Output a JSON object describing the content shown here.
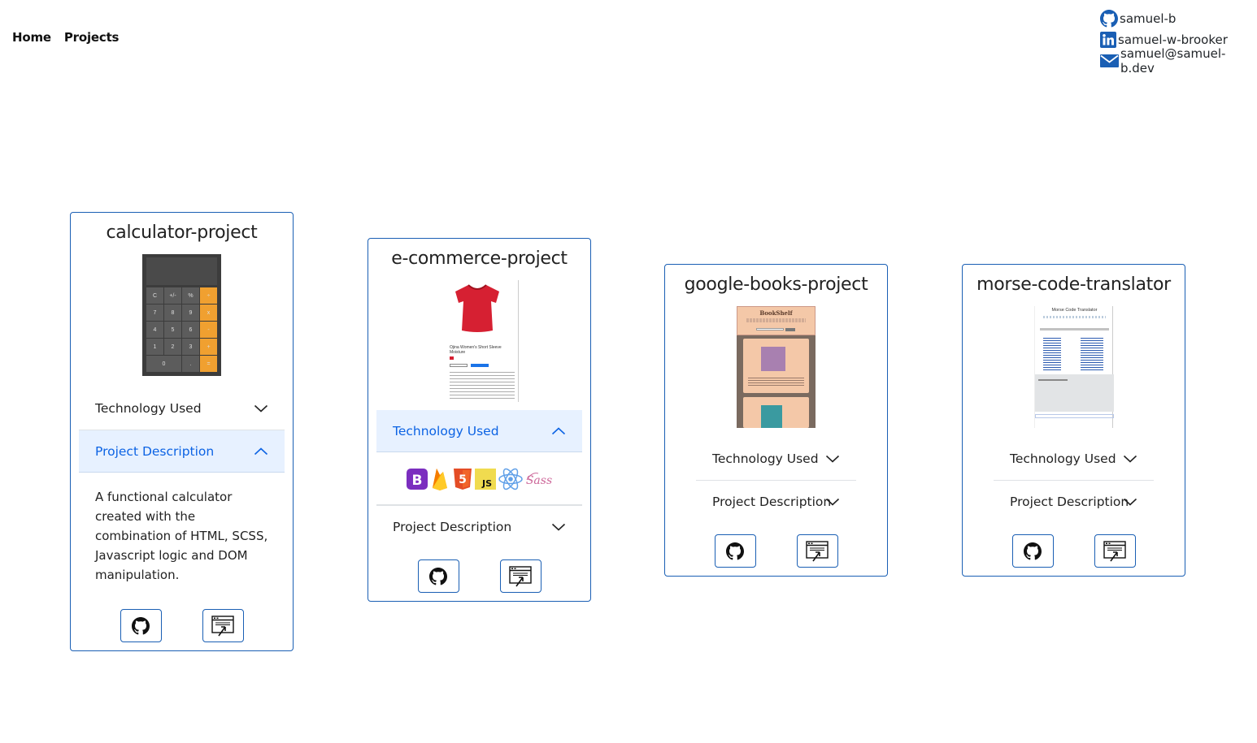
{
  "nav": {
    "home": "Home",
    "projects": "Projects"
  },
  "contacts": {
    "github": "samuel-b",
    "linkedin": "samuel-w-brooker",
    "email": "samuel@samuel-b.dev"
  },
  "accordion": {
    "tech_label": "Technology Used",
    "desc_label": "Project Description"
  },
  "projects": [
    {
      "title": "calculator-project",
      "description": "A functional calculator created with the combination of HTML, SCSS, Javascript logic and DOM manipulation.",
      "calc_keys": [
        "C",
        "+/-",
        "%",
        "÷",
        "7",
        "8",
        "9",
        "x",
        "4",
        "5",
        "6",
        "-",
        "1",
        "2",
        "3",
        "+",
        "0",
        ".",
        "="
      ]
    },
    {
      "title": "e-commerce-project",
      "product_name": "Ojina Women's Short Sleeve Moisture",
      "tech_icons": [
        "bootstrap-icon",
        "firebase-icon",
        "html5-icon",
        "javascript-icon",
        "react-icon",
        "sass-icon"
      ]
    },
    {
      "title": "google-books-project",
      "screenshot_heading": "BookShelf"
    },
    {
      "title": "morse-code-translator",
      "screenshot_heading": "Morse Code Translator"
    }
  ],
  "colors": {
    "accent": "#1a5fb4",
    "open_bg": "#e7f1ff",
    "open_text": "#0c63e4"
  }
}
